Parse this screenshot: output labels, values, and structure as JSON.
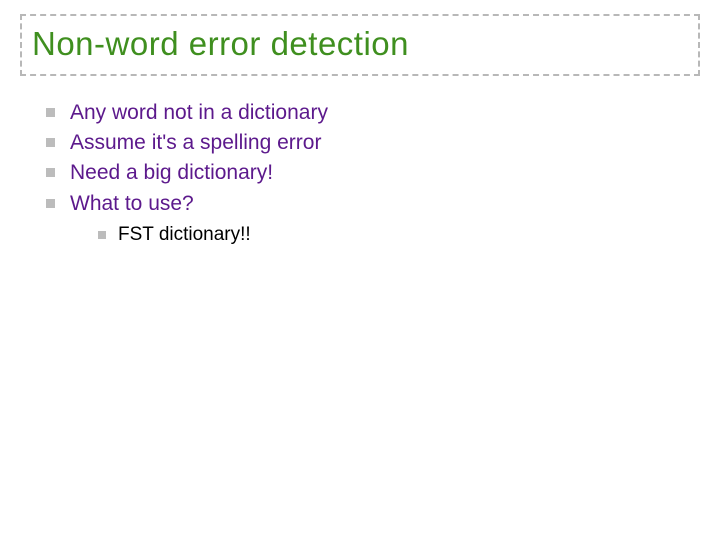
{
  "title": "Non-word error detection",
  "bullets": {
    "b0": "Any word not in a dictionary",
    "b1": "Assume it's a spelling error",
    "b2": "Need a big dictionary!",
    "b3": "What to use?",
    "sub0": "FST dictionary!!"
  }
}
